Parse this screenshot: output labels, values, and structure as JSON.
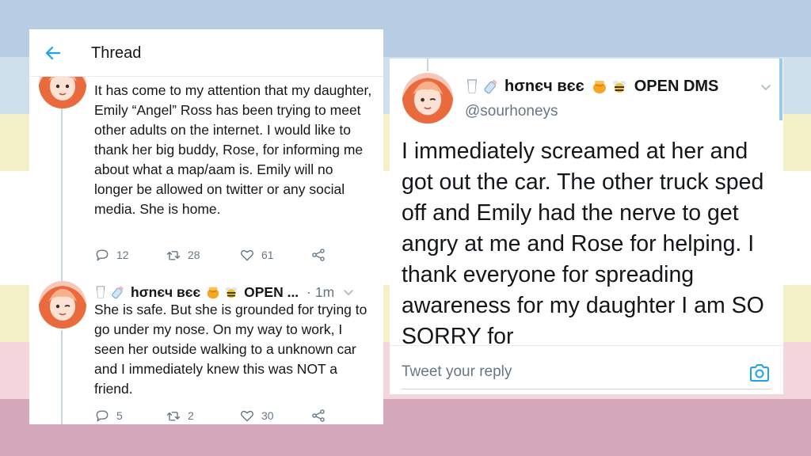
{
  "background": {
    "stripe_colors": [
      "#b8cde4",
      "#cde0ec",
      "#f4f1c9",
      "#ffffff",
      "#f4f1c9",
      "#f3d5db",
      "#d4a7ba"
    ]
  },
  "left_panel": {
    "header": {
      "back_icon": "arrow-left-icon",
      "title": "Thread"
    },
    "tweet1": {
      "text": "It has come to my attention that my daughter, Emily “Angel” Ross has been trying to meet other adults on the internet. I would like to thank her big buddy, Rose, for informing me about what a map/aam is. Emily will no longer be allowed on twitter or any social media. She is home.",
      "replies": "12",
      "retweets": "28",
      "likes": "61"
    },
    "tweet2": {
      "name": "hσnєч вєє",
      "name_suffix": "OPEN ...",
      "time": "· 1m",
      "text": "She is safe. But she is grounded for trying to go under my nose. On my way to work, I seen her outside walking to a unknown car and I immediately knew this was NOT a friend.",
      "replies": "5",
      "retweets": "2",
      "likes": "30"
    }
  },
  "right_panel": {
    "name": "hσnєч вєє",
    "name_suffix": "OPEN DMS",
    "handle": "@sourhoneys",
    "text": "I immediately screamed at her and got out the car. The other truck sped off and Emily had the nerve to get angry at me and Rose for helping. I thank everyone for spreading awareness for my daughter I am SO SORRY for",
    "reply_placeholder": "Tweet your reply",
    "camera_icon": "camera-icon"
  },
  "accent_color": "#1da1f2"
}
